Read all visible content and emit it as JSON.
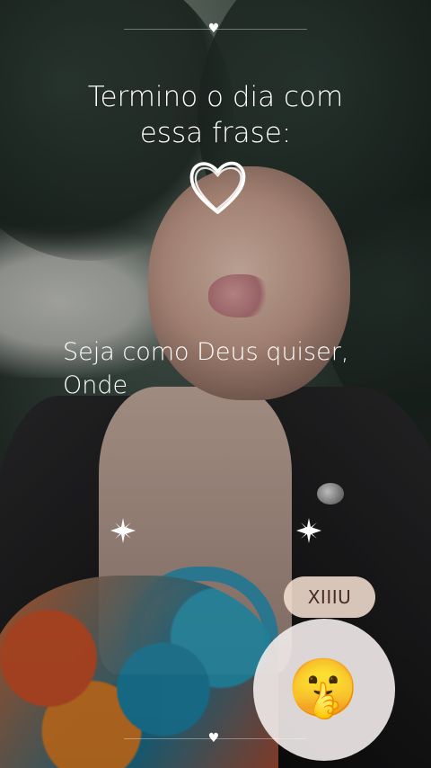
{
  "post": {
    "title": "Termino o dia com essa frase:",
    "body": "Seja como Deus quiser, Onde"
  },
  "reaction": {
    "label": "XIIIU",
    "emoji": "🤫"
  },
  "decor": {
    "small_heart_glyph": "♥",
    "icons": [
      "heart-icon",
      "sparkle-icon"
    ],
    "colors": {
      "text": "#ffffff",
      "pill_bg": "#f4ded2",
      "circle_bg": "#eee8e7"
    }
  }
}
